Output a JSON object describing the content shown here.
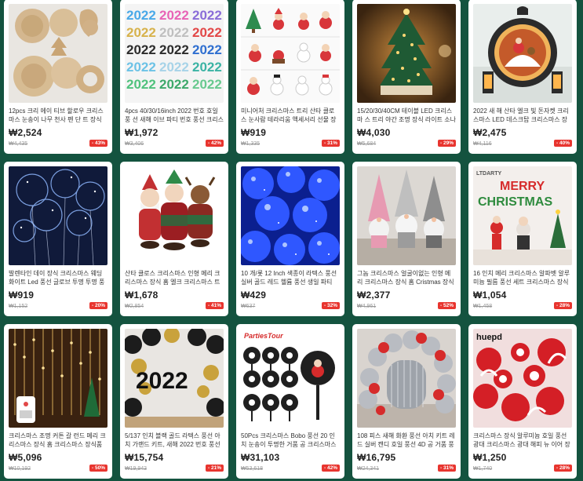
{
  "products": [
    {
      "title": "12pcs 크리 에이 티브 할로우 크리스 마스 눈송이 나무 천사 펜 단 트 장식 빈티지 나무 장식 DIY 공예",
      "price": "₩2,524",
      "original": "₩4,435",
      "discount": "- 43%",
      "icon": "wooden-ornaments-icon"
    },
    {
      "title": "4pcs 40/30/16inch 2022 번호 호일 풍 선 새해 이브 파티 번호 풍선 크리스마스 장식",
      "price": "₩1,972",
      "original": "₩3,406",
      "discount": "- 42%",
      "icon": "number-balloons-icon"
    },
    {
      "title": "미니어처 크리스마스 트리 산타 클로 스 눈사람 테라리움 액세서리 선물 장식",
      "price": "₩919",
      "original": "₩1,335",
      "discount": "- 31%",
      "icon": "miniature-figures-icon"
    },
    {
      "title": "15/20/30/40CM 테이블 LED 크리스마 스 트리 야간 조명 장식 라이트 소나무 선물",
      "price": "₩4,030",
      "original": "₩5,684",
      "discount": "- 29%",
      "icon": "led-tree-icon"
    },
    {
      "title": "2022 새 해 산타 엘크 빛 돈자켓 크리 스마스 LED 데스크탑 크리스마스 장식 램프",
      "price": "₩2,475",
      "original": "₩4,116",
      "discount": "- 40%",
      "icon": "lantern-icon"
    },
    {
      "title": "발렌타인 데이 장식 크리스마스 웨딩 화이트 Led 풍선 글로브 투명 투명 풍선",
      "price": "₩919",
      "original": "₩1,152",
      "discount": "- 20%",
      "icon": "led-balloons-icon"
    },
    {
      "title": "산타 클로스 크리스마스 인형 메리 크 리스마스 장식 홈 엘크 크리스마스 트리 장식",
      "price": "₩1,678",
      "original": "₩2,854",
      "discount": "- 41%",
      "icon": "plush-dolls-icon"
    },
    {
      "title": "10 개/롯 12 Inch 색종이 라텍스 풍선 실버 골드 레드 헬륨 풍선 생일 파티",
      "price": "₩429",
      "original": "₩637",
      "discount": "- 32%",
      "icon": "blue-balloons-icon"
    },
    {
      "title": "그놈 크리스마스 얼굴이없는 인형 메 리 크리스마스 장식 홈 Cristmas 장식",
      "price": "₩2,377",
      "original": "₩4,961",
      "discount": "- 52%",
      "icon": "gnome-dolls-icon"
    },
    {
      "title": "16 인치 메리 크리스마스 알파벳 알루 미늄 필름 풍선 세트 크리스마스 장식",
      "price": "₩1,054",
      "original": "₩1,458",
      "discount": "- 28%",
      "icon": "merry-christmas-balloons-icon"
    },
    {
      "title": "크리스마스 조명 커튼 갈 런드 메리 크 리스마스 장식 홈 크리스마스 장식품",
      "price": "₩5,096",
      "original": "₩10,192",
      "discount": "- 50%",
      "icon": "curtain-lights-icon"
    },
    {
      "title": "5/137 인치 블랙 골드 라텍스 풍선 아 치 가랜드 키트, 새해 2022 번호 풍선",
      "price": "₩15,754",
      "original": "₩19,943",
      "discount": "- 21%",
      "icon": "balloon-arch-icon"
    },
    {
      "title": "50Pcs 크리스마스 Bobo 풍선 20 인치 눈송이 투명한 거품 공 크리스마스 장식",
      "price": "₩31,103",
      "original": "₩53,618",
      "discount": "- 42%",
      "icon": "cake-toppers-icon"
    },
    {
      "title": "108 피스 새해 화환 풍선 아치 키트 레 드 실버 캔디 호일 풍선 4D 공 거품 풍선",
      "price": "₩16,795",
      "original": "₩24,341",
      "discount": "- 31%",
      "icon": "silver-arch-icon"
    },
    {
      "title": "크리스마스 장식 알루미늄 호일 풍선 광대 크리스마스 광대 해피 뉴 이어 장식",
      "price": "₩1,250",
      "original": "₩1,740",
      "discount": "- 28%",
      "icon": "candy-balloons-icon"
    }
  ],
  "image_text": {
    "p1": "2022",
    "p9": "LTDARTY",
    "p9b": "MERRY",
    "p9c": "CHRISTMAS",
    "p11": "2022",
    "p12": "PartiesTour",
    "p14": "huepd"
  },
  "colors": {
    "background": "#14533f",
    "discount_badge": "#e8352f"
  }
}
